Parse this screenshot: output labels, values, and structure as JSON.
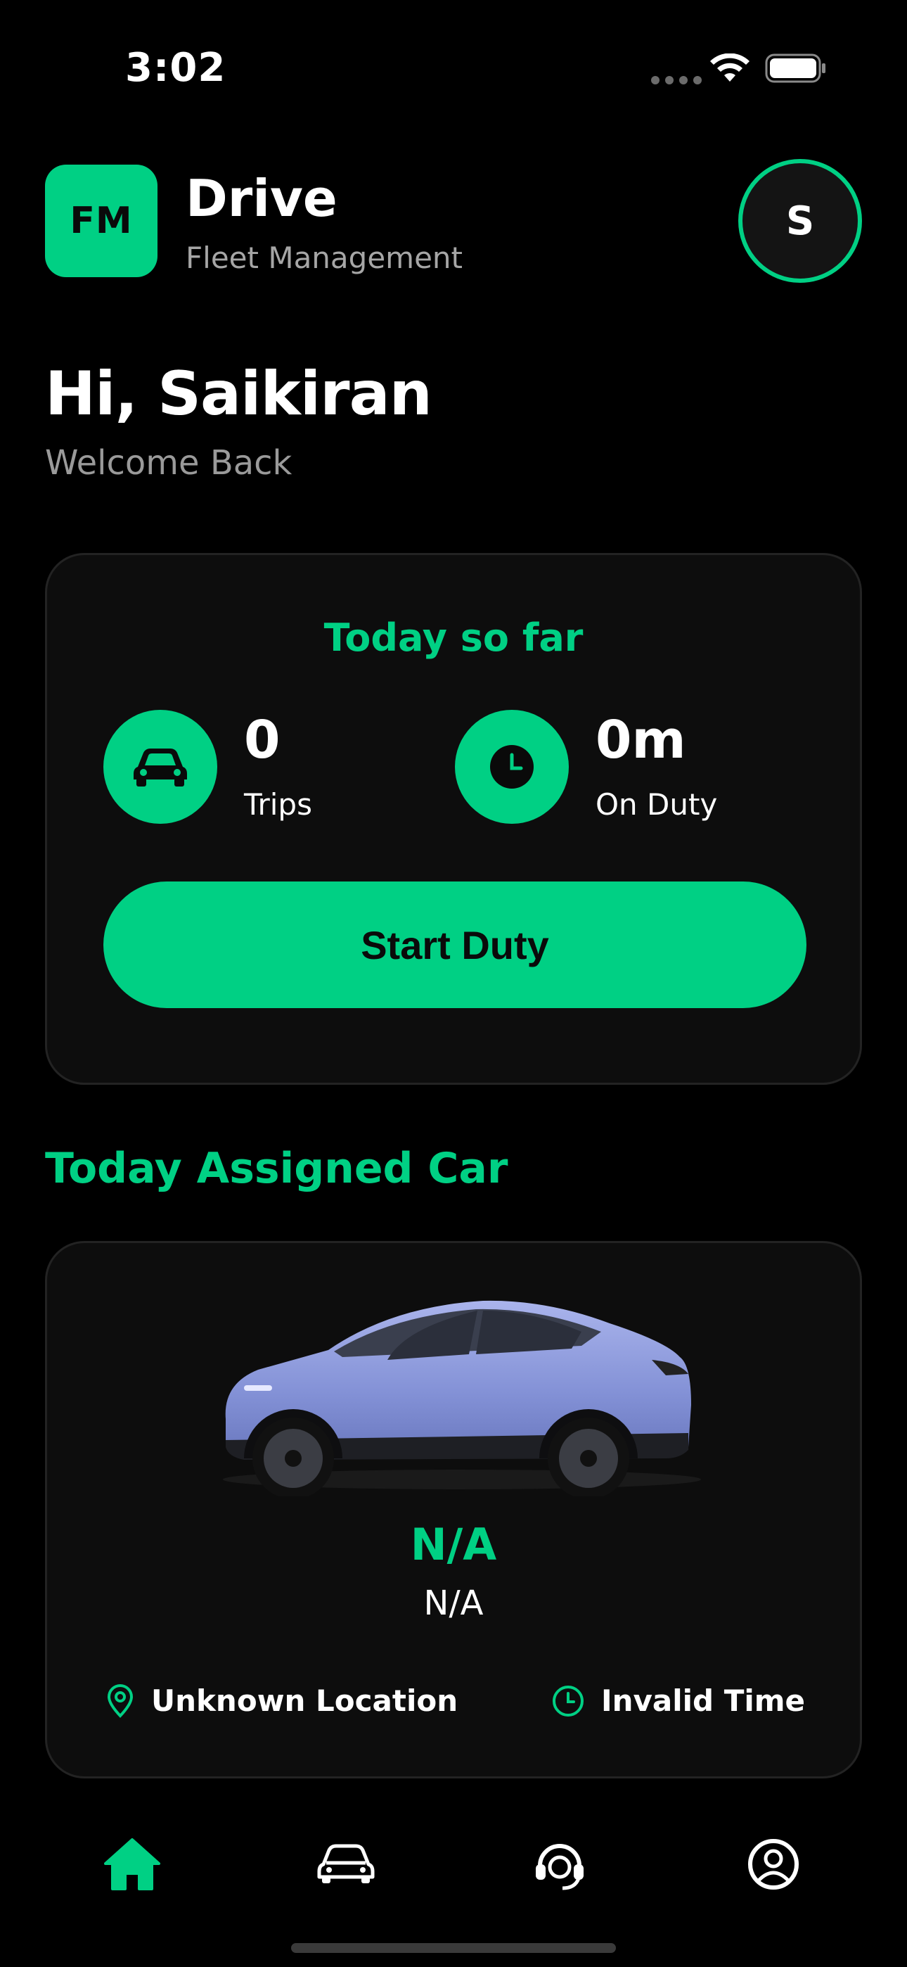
{
  "status_bar": {
    "time": "3:02"
  },
  "header": {
    "logo_text": "FM",
    "title": "Drive",
    "subtitle": "Fleet Management",
    "avatar_initial": "S"
  },
  "greeting": {
    "title": "Hi, Saikiran",
    "subtitle": "Welcome Back"
  },
  "today_card": {
    "heading": "Today so far",
    "trips": {
      "value": "0",
      "label": "Trips",
      "icon": "car-icon"
    },
    "duty": {
      "value": "0m",
      "label": "On Duty",
      "icon": "clock-icon"
    },
    "button_label": "Start Duty"
  },
  "assigned_section": {
    "title": "Today Assigned Car"
  },
  "car_card": {
    "image": "car-image",
    "plate": "N/A",
    "model": "N/A",
    "location": {
      "icon": "location-pin-icon",
      "text": "Unknown Location"
    },
    "time": {
      "icon": "clock-icon",
      "text": "Invalid Time"
    }
  },
  "bottom_nav": {
    "items": [
      {
        "icon": "home-icon",
        "active": true
      },
      {
        "icon": "car-icon",
        "active": false
      },
      {
        "icon": "support-icon",
        "active": false
      },
      {
        "icon": "profile-icon",
        "active": false
      }
    ]
  },
  "colors": {
    "accent": "#00d084",
    "background": "#000000",
    "card": "#0d0d0d",
    "muted_text": "#a6a6a6"
  }
}
